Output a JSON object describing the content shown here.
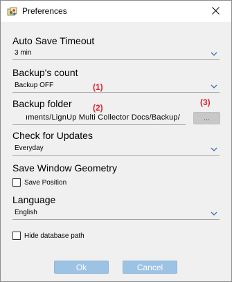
{
  "window": {
    "title": "Preferences",
    "app_icon": "colorful-app-icon",
    "close_icon": "close-icon"
  },
  "auto_save": {
    "label": "Auto Save Timeout",
    "value": "3 min"
  },
  "backup_count": {
    "label": "Backup's count",
    "value": "Backup OFF",
    "annotation": "(1)"
  },
  "backup_folder": {
    "label": "Backup folder",
    "annotation_path": "(2)",
    "path": "ıments/LignUp Multi Collector Docs/Backup/",
    "browse_label": "...",
    "annotation_browse": "(3)"
  },
  "updates": {
    "label": "Check for Updates",
    "value": "Everyday"
  },
  "geometry": {
    "label": "Save Window Geometry",
    "checkbox_label": "Save Position",
    "checked": false
  },
  "language": {
    "label": "Language",
    "value": "English"
  },
  "hide_db": {
    "checkbox_label": "Hide database path",
    "checked": false
  },
  "buttons": {
    "ok": "Ok",
    "cancel": "Cancel"
  },
  "colors": {
    "annotation": "#d8252f",
    "button_bg": "#9dc3e4",
    "arrow": "#3c6fb4"
  }
}
